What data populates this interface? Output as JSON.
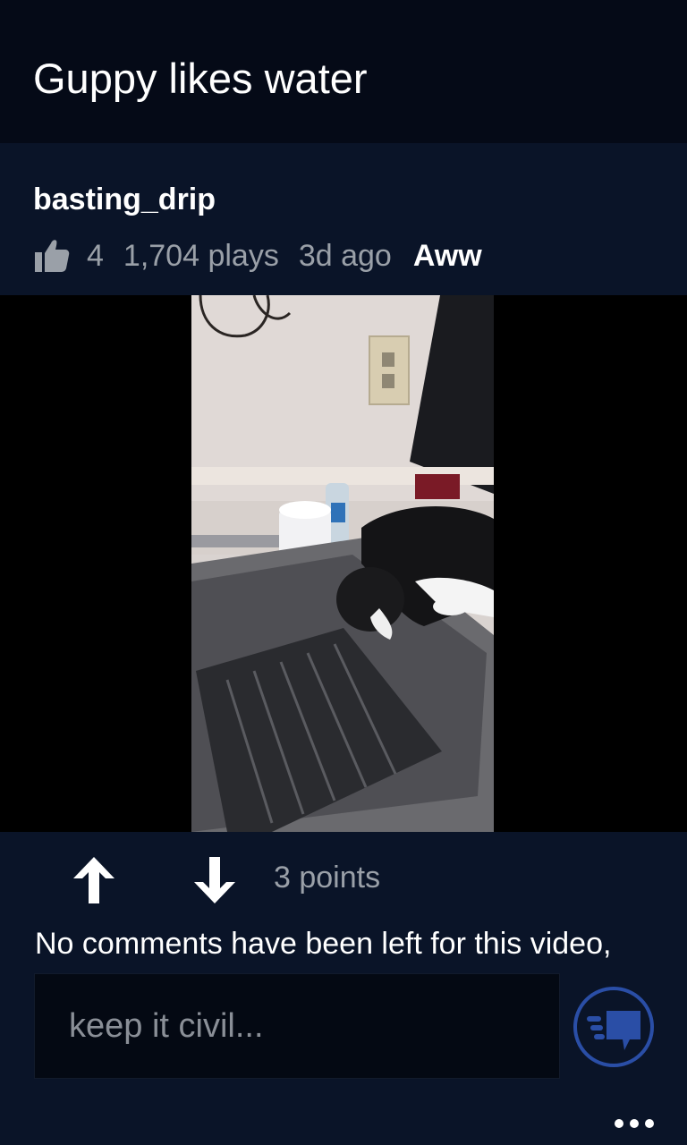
{
  "post": {
    "title": "Guppy likes water",
    "author": "basting_drip",
    "likes": "4",
    "plays": "1,704 plays",
    "age": "3d ago",
    "subreddit": "Aww"
  },
  "video": {
    "thumbnail_icon": "video-frame-cat-at-sink"
  },
  "voting": {
    "upvote_icon": "arrow-up-icon",
    "downvote_icon": "arrow-down-icon",
    "points": "3 points"
  },
  "comments": {
    "empty_message": "No comments have been left for this video,",
    "input_placeholder": "keep it civil...",
    "send_icon": "comment-send-icon"
  },
  "appbar": {
    "more_icon": "ellipsis-icon"
  },
  "colors": {
    "background": "#050a17",
    "panel": "#0a1428",
    "accent": "#2a4ea6",
    "muted_text": "#9aa0a8"
  }
}
